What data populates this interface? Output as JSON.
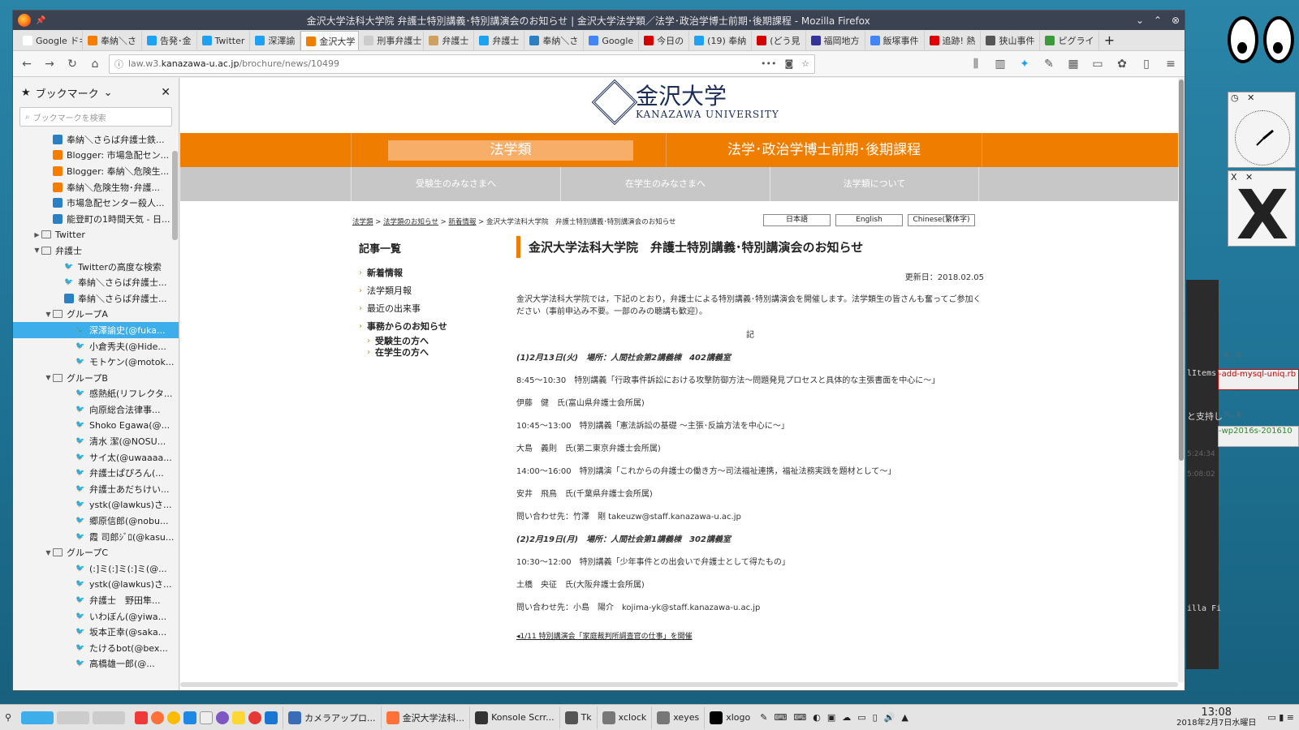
{
  "window": {
    "title": "金沢大学法科大学院 弁護士特別講義･特別講演会のお知らせ | 金沢大学法学類／法学･政治学博士前期･後期課程 - Mozilla Firefox"
  },
  "tabs": [
    {
      "label": "Google ドキ",
      "color": "#ffffff"
    },
    {
      "label": "奉納＼さ",
      "color": "#f57d00"
    },
    {
      "label": "告発･金",
      "color": "#1da1f2"
    },
    {
      "label": "Twitter",
      "color": "#1da1f2"
    },
    {
      "label": "深澤諭",
      "color": "#1da1f2"
    },
    {
      "label": "金沢大学",
      "color": "#ef7e00",
      "active": true
    },
    {
      "label": "刑事弁護士",
      "color": "#cccccc"
    },
    {
      "label": "弁護士",
      "color": "#d0a060"
    },
    {
      "label": "弁護士",
      "color": "#1da1f2"
    },
    {
      "label": "奉納＼さ",
      "color": "#2b80c3"
    },
    {
      "label": "Google",
      "color": "#4285f4"
    },
    {
      "label": "今日の",
      "color": "#d40000"
    },
    {
      "label": "(19) 奉納",
      "color": "#1da1f2"
    },
    {
      "label": "(どう見",
      "color": "#d40000"
    },
    {
      "label": "福岡地方",
      "color": "#333399"
    },
    {
      "label": "飯塚事件",
      "color": "#4285f4"
    },
    {
      "label": "追跡! 熱",
      "color": "#e00000"
    },
    {
      "label": "狭山事件",
      "color": "#555555"
    },
    {
      "label": "ピグライ",
      "color": "#3c9a3c"
    }
  ],
  "url": {
    "prefix": "law.w3.",
    "domain": "kanazawa-u.ac.jp",
    "path": "/brochure/news/10499"
  },
  "sidebar": {
    "title": "ブックマーク",
    "search_placeholder": "ブックマークを検索",
    "items": [
      {
        "label": "奉納＼さらば弁護士鉄...",
        "indent": 3,
        "icon": "tw2"
      },
      {
        "label": "Blogger: 市場急配セン...",
        "indent": 3,
        "icon": "blogger"
      },
      {
        "label": "Blogger: 奉納＼危険生...",
        "indent": 3,
        "icon": "blogger"
      },
      {
        "label": "奉納＼危険生物･弁護...",
        "indent": 3,
        "icon": "blogger"
      },
      {
        "label": "市場急配センター殺人...",
        "indent": 3,
        "icon": "tw2"
      },
      {
        "label": "能登町の1時間天気 - 日...",
        "indent": 3,
        "icon": "tw2"
      },
      {
        "label": "Twitter",
        "indent": 2,
        "icon": "folder",
        "tw": "▶"
      },
      {
        "label": "弁護士",
        "indent": 2,
        "icon": "folder",
        "tw": "▼"
      },
      {
        "label": "Twitterの高度な検索",
        "indent": 4,
        "icon": "bird"
      },
      {
        "label": "奉納＼さらば弁護士...",
        "indent": 4,
        "icon": "bird"
      },
      {
        "label": "奉納＼さらば弁護士...",
        "indent": 4,
        "icon": "tw2"
      },
      {
        "label": "グループA",
        "indent": 3,
        "icon": "folder",
        "tw": "▼"
      },
      {
        "label": "深澤諭史(@fuka...",
        "indent": 5,
        "icon": "bird",
        "sel": true
      },
      {
        "label": "小倉秀夫(@Hide...",
        "indent": 5,
        "icon": "bird"
      },
      {
        "label": "モトケン(@motok...",
        "indent": 5,
        "icon": "bird"
      },
      {
        "label": "グループB",
        "indent": 3,
        "icon": "folder",
        "tw": "▼"
      },
      {
        "label": "感熱紙(リフレクタ...",
        "indent": 5,
        "icon": "bird"
      },
      {
        "label": "向原総合法律事...",
        "indent": 5,
        "icon": "bird"
      },
      {
        "label": "Shoko Egawa(@...",
        "indent": 5,
        "icon": "bird"
      },
      {
        "label": "清水 潔(@NOSU...",
        "indent": 5,
        "icon": "bird"
      },
      {
        "label": "サイ太(@uwaaaa...",
        "indent": 5,
        "icon": "bird"
      },
      {
        "label": "弁護士ぱぴろん(...",
        "indent": 5,
        "icon": "bird"
      },
      {
        "label": "弁護士あだちけい...",
        "indent": 5,
        "icon": "bird"
      },
      {
        "label": "ystk(@lawkus)さ...",
        "indent": 5,
        "icon": "bird"
      },
      {
        "label": "郷原信郎(@nobu...",
        "indent": 5,
        "icon": "bird"
      },
      {
        "label": "霞 司郎ｼﾞﾛ(@kasu...",
        "indent": 5,
        "icon": "bird"
      },
      {
        "label": "グループC",
        "indent": 3,
        "icon": "folder",
        "tw": "▼"
      },
      {
        "label": "(:]ミ(:]ミ(:]ミ(@...",
        "indent": 5,
        "icon": "bird"
      },
      {
        "label": "ystk(@lawkus)さ...",
        "indent": 5,
        "icon": "bird"
      },
      {
        "label": "弁護士　野田隼...",
        "indent": 5,
        "icon": "bird"
      },
      {
        "label": "いわぼん(@yiwa...",
        "indent": 5,
        "icon": "bird"
      },
      {
        "label": "坂本正幸(@saka...",
        "indent": 5,
        "icon": "bird"
      },
      {
        "label": "たけるbot(@bex...",
        "indent": 5,
        "icon": "bird"
      },
      {
        "label": "高橋雄一郎(@...",
        "indent": 5,
        "icon": "bird"
      }
    ]
  },
  "site": {
    "logo_jp": "金沢大学",
    "logo_en": "KANAZAWA UNIVERSITY",
    "nav_primary": [
      "法学類",
      "法学･政治学博士前期･後期課程"
    ],
    "nav_secondary": [
      "受験生のみなさまへ",
      "在学生のみなさまへ",
      "法学類について"
    ],
    "breadcrumb": [
      "法学類",
      "法学類のお知らせ",
      "新着情報",
      "金沢大学法科大学院　弁護士特別講義･特別講演会のお知らせ"
    ],
    "languages": [
      "日本語",
      "English",
      "Chinese(繁体字)"
    ],
    "side_menu": {
      "title": "記事一覧",
      "items": [
        {
          "label": "新着情報",
          "bold": true
        },
        {
          "label": "法学類月報",
          "bold": false
        },
        {
          "label": "最近の出来事",
          "bold": false
        },
        {
          "label": "事務からのお知らせ",
          "bold": true
        }
      ],
      "subitems": [
        "受験生の方へ",
        "在学生の方へ"
      ]
    },
    "article": {
      "title": "金沢大学法科大学院　弁護士特別講義･特別講演会のお知らせ",
      "updated": "更新日：2018.02.05",
      "intro": "金沢大学法科大学院では，下記のとおり，弁護士による特別講義･特別講演会を開催します。法学類生の皆さんも奮ってご参加ください（事前申込み不要。一部のみの聴講も歓迎）。",
      "ki": "記",
      "rows": [
        {
          "text": "(1)2月13日(火)　場所：人間社会第2講義棟　402講義室",
          "em": true
        },
        {
          "text": "8:45～10:30　特別講義「行政事件訴訟における攻撃防御方法～問題発見プロセスと具体的な主張書面を中心に～」"
        },
        {
          "text": "伊藤　健　氏(富山県弁護士会所属)"
        },
        {
          "text": "10:45～13:00　特別講義「憲法訴訟の基礎 ～主張･反論方法を中心に～」"
        },
        {
          "text": "大島　義則　氏(第二東京弁護士会所属)"
        },
        {
          "text": "14:00～16:00　特別講演「これからの弁護士の働き方～司法福祉連携，福祉法務実践を題材として～」"
        },
        {
          "text": "安井　飛鳥　氏(千葉県弁護士会所属)"
        },
        {
          "text": "問い合わせ先：竹澤　剛 takeuzw@staff.kanazawa-u.ac.jp"
        },
        {
          "text": "(2)2月19日(月)　場所：人間社会第1講義棟　302講義室",
          "em": true
        },
        {
          "text": "10:30～12:00　特別講義「少年事件との出会いで弁護士として得たもの」"
        },
        {
          "text": "土橋　央征　氏(大阪弁護士会所属)"
        },
        {
          "text": "問い合わせ先：小島　陽介　kojima-yk@staff.kanazawa-u.ac.jp"
        }
      ],
      "prev_link": "1/11 特別講演会「家庭裁判所調査官の仕事」を開催"
    }
  },
  "desktop": {
    "terminal_fragments": [
      "lItems'",
      "-add-mysql-uniq.rb",
      "と支持し",
      "-wp2016s-201610",
      "illa Fi",
      "s...q",
      "h...k",
      "5:24:34",
      "5:08:02"
    ]
  },
  "taskbar": {
    "windows": [
      {
        "label": "カメラアップロ...",
        "color": "#3a6db5"
      },
      {
        "label": "金沢大学法科...",
        "color": "#ff7139"
      },
      {
        "label": "Konsole Scrr...",
        "color": "#333333"
      },
      {
        "label": "Tk",
        "color": "#555555"
      },
      {
        "label": "xclock",
        "color": "#777777"
      },
      {
        "label": "xeyes",
        "color": "#777777"
      },
      {
        "label": "xlogo",
        "color": "#000000"
      }
    ],
    "time": "13:08",
    "date": "2018年2月7日水曜日"
  }
}
